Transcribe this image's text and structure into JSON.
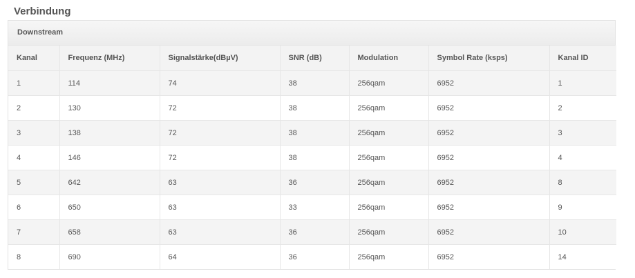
{
  "section_title": "Verbindung",
  "panel": {
    "title": "Downstream",
    "columns": [
      "Kanal",
      "Frequenz (MHz)",
      "Signalstärke(dBµV)",
      "SNR (dB)",
      "Modulation",
      "Symbol Rate (ksps)",
      "Kanal ID"
    ],
    "rows": [
      [
        "1",
        "114",
        "74",
        "38",
        "256qam",
        "6952",
        "1"
      ],
      [
        "2",
        "130",
        "72",
        "38",
        "256qam",
        "6952",
        "2"
      ],
      [
        "3",
        "138",
        "72",
        "38",
        "256qam",
        "6952",
        "3"
      ],
      [
        "4",
        "146",
        "72",
        "38",
        "256qam",
        "6952",
        "4"
      ],
      [
        "5",
        "642",
        "63",
        "36",
        "256qam",
        "6952",
        "8"
      ],
      [
        "6",
        "650",
        "63",
        "33",
        "256qam",
        "6952",
        "9"
      ],
      [
        "7",
        "658",
        "63",
        "36",
        "256qam",
        "6952",
        "10"
      ],
      [
        "8",
        "690",
        "64",
        "36",
        "256qam",
        "6952",
        "14"
      ]
    ]
  }
}
